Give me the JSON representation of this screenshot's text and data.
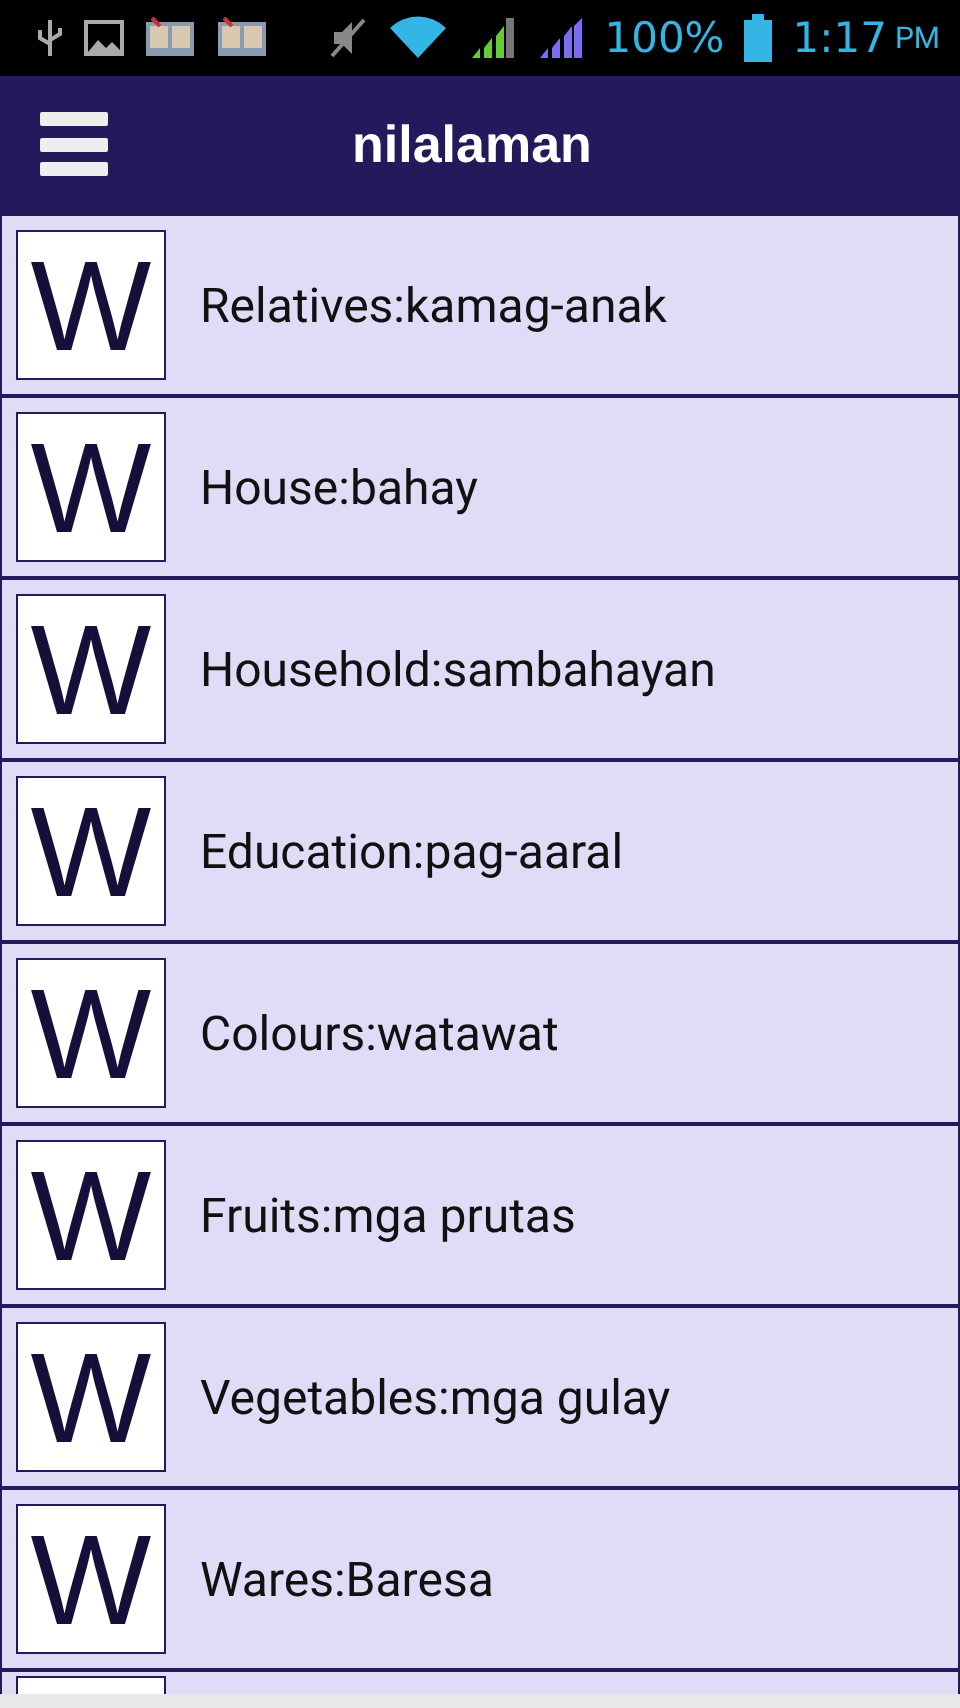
{
  "status_bar": {
    "battery": "100%",
    "time": "1:17",
    "meridiem": "PM"
  },
  "app_bar": {
    "title": "nilalaman"
  },
  "items": [
    {
      "icon_letter": "W",
      "label": "Relatives:kamag-anak"
    },
    {
      "icon_letter": "W",
      "label": "House:bahay"
    },
    {
      "icon_letter": "W",
      "label": "Household:sambahayan"
    },
    {
      "icon_letter": "W",
      "label": "Education:pag-aaral"
    },
    {
      "icon_letter": "W",
      "label": "Colours:watawat"
    },
    {
      "icon_letter": "W",
      "label": "Fruits:mga prutas"
    },
    {
      "icon_letter": "W",
      "label": "Vegetables:mga gulay"
    },
    {
      "icon_letter": "W",
      "label": "Wares:Baresa"
    }
  ]
}
